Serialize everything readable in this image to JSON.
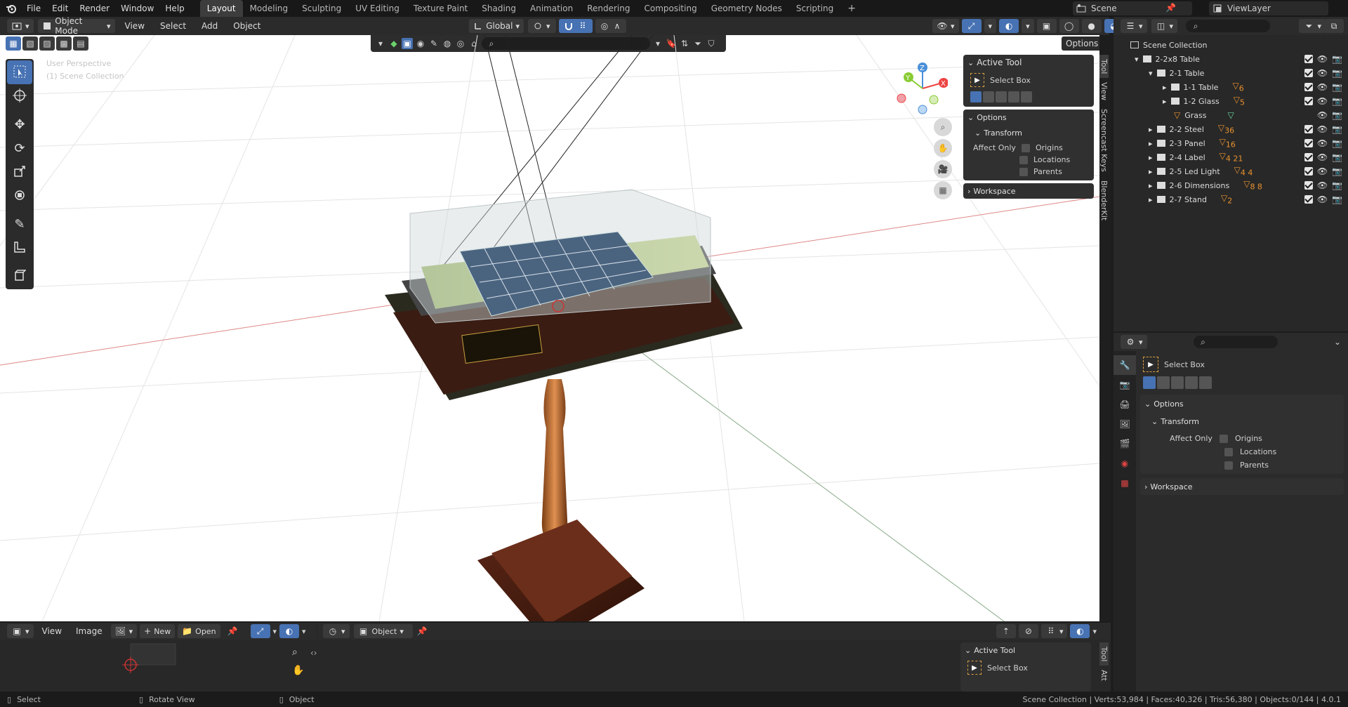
{
  "topbar": {
    "menus": [
      "File",
      "Edit",
      "Render",
      "Window",
      "Help"
    ],
    "workspaces": [
      "Layout",
      "Modeling",
      "Sculpting",
      "UV Editing",
      "Texture Paint",
      "Shading",
      "Animation",
      "Rendering",
      "Compositing",
      "Geometry Nodes",
      "Scripting"
    ],
    "active_workspace": "Layout",
    "scene_name": "Scene",
    "view_layer": "ViewLayer"
  },
  "viewport_header": {
    "mode": "Object Mode",
    "menus": [
      "View",
      "Select",
      "Add",
      "Object"
    ],
    "orientation": "Global",
    "options_label": "Options"
  },
  "viewport": {
    "perspective_label": "User Perspective",
    "collection_label": "(1) Scene Collection"
  },
  "side_tabs": [
    "Tool",
    "View",
    "Screencast Keys",
    "BlenderKit"
  ],
  "n_panel": {
    "active_tool_header": "Active Tool",
    "tool_name": "Select Box",
    "options_header": "Options",
    "transform_header": "Transform",
    "affect_only_label": "Affect Only",
    "affect_items": [
      "Origins",
      "Locations",
      "Parents"
    ],
    "workspace_header": "Workspace"
  },
  "outliner": {
    "root": "Scene Collection",
    "items": [
      {
        "label": "2-2x8 Table",
        "level": 1,
        "expanded": true,
        "badge": ""
      },
      {
        "label": "2-1 Table",
        "level": 2,
        "expanded": true,
        "badge": ""
      },
      {
        "label": "1-1 Table",
        "level": 3,
        "expanded": false,
        "badge": "6"
      },
      {
        "label": "1-2 Glass",
        "level": 3,
        "expanded": false,
        "badge": "5"
      },
      {
        "label": "Grass",
        "level": 3,
        "expanded": false,
        "badge": ""
      },
      {
        "label": "2-2 Steel",
        "level": 2,
        "expanded": false,
        "badge": "36"
      },
      {
        "label": "2-3 Panel",
        "level": 2,
        "expanded": false,
        "badge": "16"
      },
      {
        "label": "2-4 Label",
        "level": 2,
        "expanded": false,
        "badge": "4 21"
      },
      {
        "label": "2-5 Led Light",
        "level": 2,
        "expanded": false,
        "badge": "4 4"
      },
      {
        "label": "2-6 Dimensions",
        "level": 2,
        "expanded": false,
        "badge": "8 8"
      },
      {
        "label": "2-7 Stand",
        "level": 2,
        "expanded": false,
        "badge": "2"
      }
    ]
  },
  "properties": {
    "tool_name": "Select Box",
    "options_header": "Options",
    "transform_header": "Transform",
    "affect_only_label": "Affect Only",
    "affect_items": [
      "Origins",
      "Locations",
      "Parents"
    ],
    "workspace_header": "Workspace"
  },
  "bottom_editor": {
    "image_menus": [
      "View",
      "Image"
    ],
    "new_label": "New",
    "open_label": "Open",
    "object_label": "Object",
    "active_tool_header": "Active Tool",
    "tool_name": "Select Box",
    "side_tabs": [
      "Tool",
      "Att"
    ]
  },
  "statusbar": {
    "left": [
      "Select",
      "Rotate View",
      "Object"
    ],
    "right": "Scene Collection | Verts:53,984 | Faces:40,326 | Tris:56,380 | Objects:0/144 | 4.0.1"
  },
  "colors": {
    "accent_blue": "#4772b3",
    "panel_bg": "#303030",
    "header_bg": "#232323",
    "viewport_bg": "#ffffff"
  }
}
